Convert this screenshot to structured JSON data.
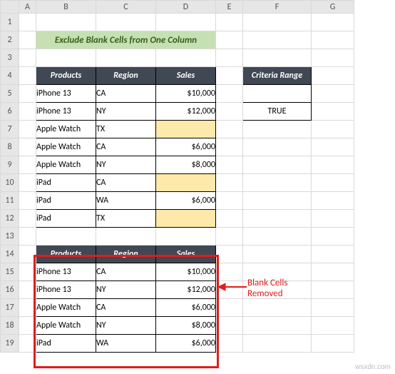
{
  "columns": [
    "A",
    "B",
    "C",
    "D",
    "E",
    "F",
    "G"
  ],
  "rows": [
    "1",
    "2",
    "3",
    "4",
    "5",
    "6",
    "7",
    "8",
    "9",
    "10",
    "11",
    "12",
    "13",
    "14",
    "15",
    "16",
    "17",
    "18",
    "19"
  ],
  "title": "Exclude Blank Cells from One Column",
  "headers": {
    "products": "Products",
    "region": "Region",
    "sales": "Sales"
  },
  "table1": [
    {
      "product": "iPhone 13",
      "region": "CA",
      "sales": "$10,000"
    },
    {
      "product": "iPhone 13",
      "region": "NY",
      "sales": "$12,000"
    },
    {
      "product": "Apple Watch",
      "region": "TX",
      "sales": ""
    },
    {
      "product": "Apple Watch",
      "region": "CA",
      "sales": "$6,000"
    },
    {
      "product": "Apple Watch",
      "region": "NY",
      "sales": "$8,000"
    },
    {
      "product": "iPad",
      "region": "CA",
      "sales": ""
    },
    {
      "product": "iPad",
      "region": "WA",
      "sales": "$6,000"
    },
    {
      "product": "iPad",
      "region": "TX",
      "sales": ""
    }
  ],
  "criteria": {
    "header": "Criteria Range",
    "blank": "",
    "value": "TRUE"
  },
  "table2": [
    {
      "product": "iPhone 13",
      "region": "CA",
      "sales": "$10,000"
    },
    {
      "product": "iPhone 13",
      "region": "NY",
      "sales": "$12,000"
    },
    {
      "product": "Apple Watch",
      "region": "CA",
      "sales": "$6,000"
    },
    {
      "product": "Apple Watch",
      "region": "NY",
      "sales": "$8,000"
    },
    {
      "product": "iPad",
      "region": "WA",
      "sales": "$6,000"
    }
  ],
  "annotation": "Blank Cells\nRemoved",
  "watermark": "wsxdn.com"
}
